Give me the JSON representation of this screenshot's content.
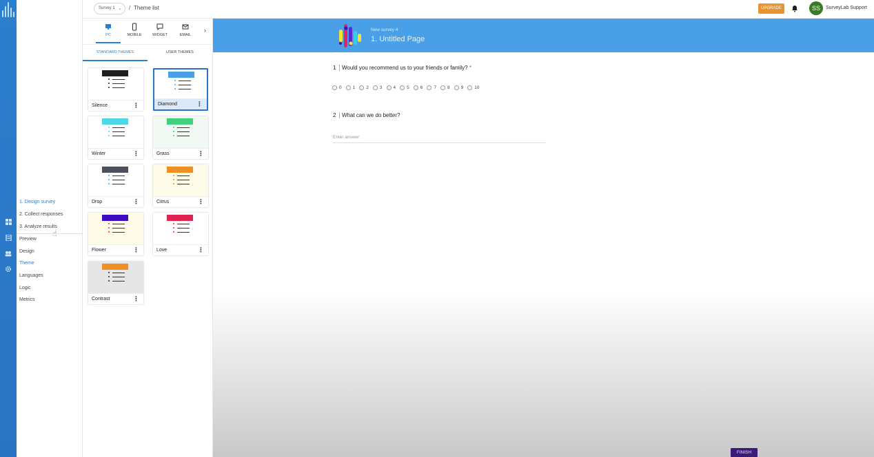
{
  "header": {
    "survey_select": "Survey 1",
    "crumb_sep": "/",
    "crumb": "Theme list",
    "upgrade_label": "UPGRADE",
    "avatar_initials": "SS",
    "username": "SurveyLab Support"
  },
  "nav": {
    "steps": [
      "1. Design survey",
      "2. Collect responses",
      "3. Analyze results"
    ],
    "subs": [
      "Preview",
      "Design",
      "Theme",
      "Languages",
      "Logic",
      "Metrics"
    ]
  },
  "panel": {
    "device_tabs": [
      "PC",
      "MOBILE",
      "WIDGET",
      "EMAIL"
    ],
    "theme_tabs": [
      "STANDARD THEMES",
      "USER THEMES"
    ],
    "themes": [
      {
        "name": "Silence",
        "bar": "#1f1f1f",
        "bg": "#ffffff",
        "dot": "#1f1f1f"
      },
      {
        "name": "Diamond",
        "bar": "#4aa0e6",
        "bg": "#ffffff",
        "dot": "#4aa0e6"
      },
      {
        "name": "Winter",
        "bar": "#4dd8e6",
        "bg": "#ffffff",
        "dot": "#4dd8e6"
      },
      {
        "name": "Grass",
        "bar": "#3fd17c",
        "bg": "#f2f8f3",
        "dot": "#3fd17c"
      },
      {
        "name": "Drop",
        "bar": "#4d4f5c",
        "bg": "#ffffff",
        "dot": "#4aa0e6"
      },
      {
        "name": "Citrus",
        "bar": "#ef8f24",
        "bg": "#fffbe9",
        "dot": "#ef8f24"
      },
      {
        "name": "Flower",
        "bar": "#3d0dbf",
        "bg": "#fffbe9",
        "dot": "#e0246a"
      },
      {
        "name": "Love",
        "bar": "#e02450",
        "bg": "#ffffff",
        "dot": "#e02450"
      },
      {
        "name": "Contrast",
        "bar": "#ef8f24",
        "bg": "#e6e6e6",
        "dot": "#222222"
      }
    ],
    "selected_theme": "Diamond"
  },
  "preview": {
    "survey_name": "New survey 4",
    "page_title": "1. Untitled Page",
    "q1_num": "1",
    "q1_text": "Would you recommend us to your friends or family?",
    "q1_required": "*",
    "scale": [
      "0",
      "1",
      "2",
      "3",
      "4",
      "5",
      "6",
      "7",
      "8",
      "9",
      "10"
    ],
    "q2_num": "2",
    "q2_text": "What can we do better?",
    "answer_placeholder": "Enter answer",
    "finish_label": "FINISH"
  },
  "colors": {
    "accent": "#2a7fd0",
    "banner": "#4aa0e6",
    "upgrade": "#e89431",
    "finish": "#3b1a78",
    "avatar": "#3a7a22"
  }
}
